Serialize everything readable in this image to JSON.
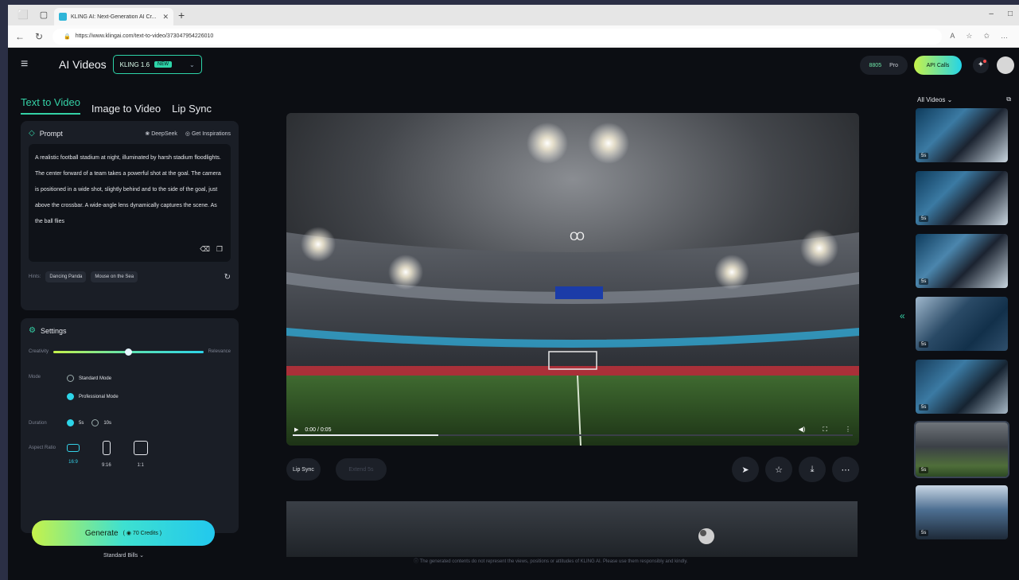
{
  "browser": {
    "tab_title": "KLING AI: Next-Generation AI Cr...",
    "url": "https://www.klingai.com/text-to-video/373047954226010"
  },
  "header": {
    "title": "AI Videos",
    "model": "KLING 1.6",
    "model_badge": "NEW",
    "credits": "8805",
    "pro": "Pro",
    "api_button": "API Calls"
  },
  "left": {
    "tabs": [
      "Text to Video",
      "Image to Video",
      "Lip Sync"
    ],
    "prompt": {
      "label": "Prompt",
      "deepseek": "DeepSeek",
      "inspirations": "Get Inspirations",
      "text": "A realistic football stadium at night, illuminated by harsh stadium floodlights. The center forward of a team takes a powerful shot at the goal. The camera is positioned in a wide shot, slightly behind and to the side of the goal, just above the crossbar. A wide-angle lens dynamically captures the scene. As the ball flies"
    },
    "hints": {
      "label": "Hints:",
      "chip1": "Dancing Panda",
      "chip2": "Mouse on the Sea"
    },
    "settings": {
      "label": "Settings",
      "creativity": "Creativity",
      "relevance": "Relevance",
      "creativity_value": 0.5,
      "mode_label": "Mode",
      "standard": "Standard Mode",
      "professional": "Professional Mode",
      "duration_label": "Duration",
      "dur_5": "5s",
      "dur_10": "10s",
      "aspect_label": "Aspect Ratio",
      "aspects": [
        "16:9",
        "9:16",
        "1:1"
      ]
    },
    "generate": "Generate",
    "generate_credits": "70 Credits",
    "benefits": "Standard Bills"
  },
  "player": {
    "time": "0:00 / 0:05",
    "progress": 0.26
  },
  "actions": {
    "lip_sync": "Lip Sync",
    "extend": "Extend 5s"
  },
  "disclaimer": "The generated contents do not represent the views, positions or attitudes of KLING AI. Please use them responsibly and kindly.",
  "right": {
    "title": "All Videos",
    "thumbs": [
      "5s",
      "5s",
      "5s",
      "5s",
      "5s",
      "5s",
      "5s"
    ]
  }
}
